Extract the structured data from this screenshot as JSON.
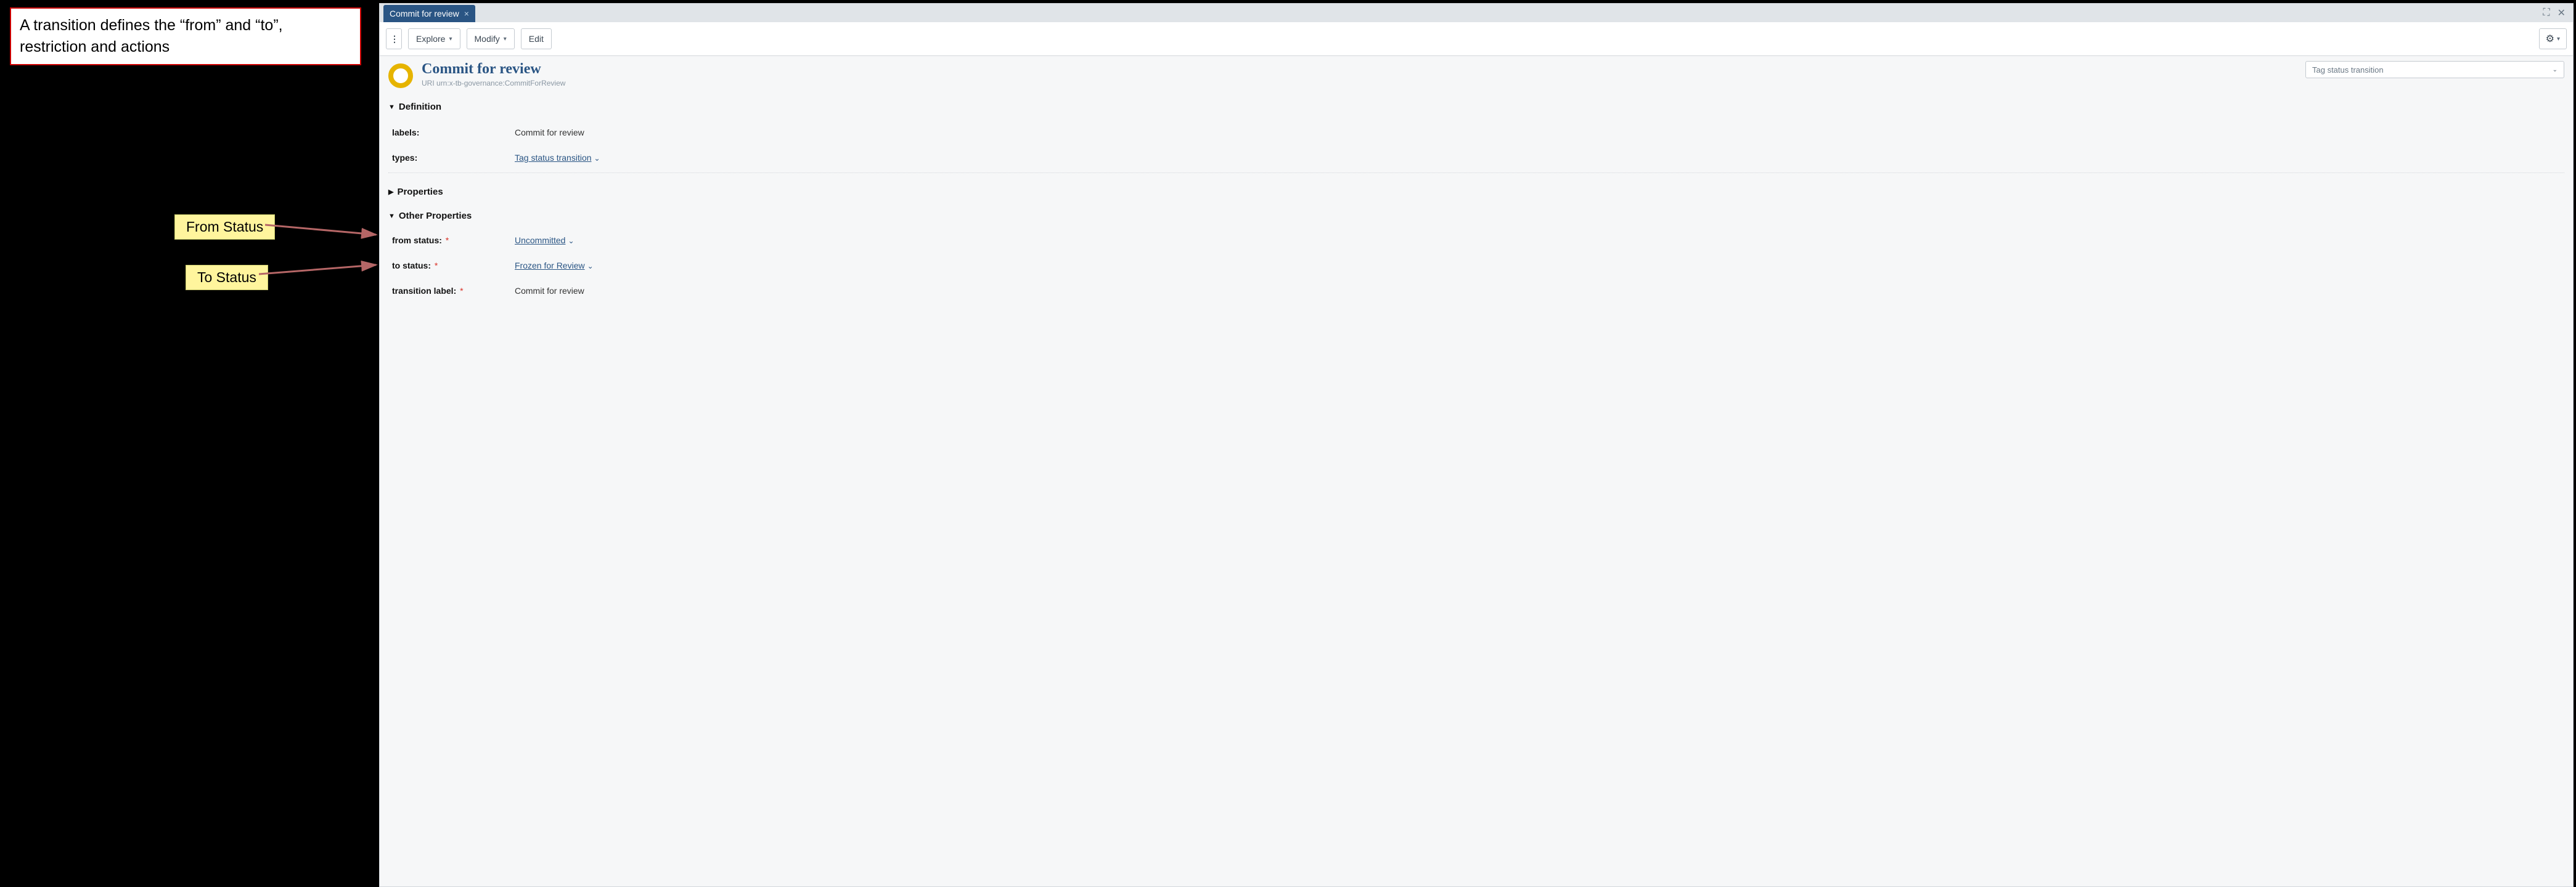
{
  "note": "A transition defines the “from” and “to”, restriction and actions",
  "callouts": {
    "from": "From Status",
    "to": "To Status"
  },
  "tab": {
    "title": "Commit for review"
  },
  "toolbar": {
    "explore": "Explore",
    "modify": "Modify",
    "edit": "Edit"
  },
  "header": {
    "title": "Commit for review",
    "uri_label": "URI",
    "uri": "urn:x-tb-governance:CommitForReview"
  },
  "typeSelector": {
    "value": "Tag status transition"
  },
  "sections": {
    "definition": {
      "label": "Definition",
      "labels_key": "labels:",
      "labels_val": "Commit for review",
      "types_key": "types:",
      "types_val": "Tag status transition"
    },
    "properties": {
      "label": "Properties"
    },
    "other": {
      "label": "Other Properties",
      "from_key": "from status:",
      "from_val": "Uncommitted",
      "to_key": "to status:",
      "to_val": "Frozen for Review",
      "tl_key": "transition label:",
      "tl_val": "Commit for review"
    }
  }
}
